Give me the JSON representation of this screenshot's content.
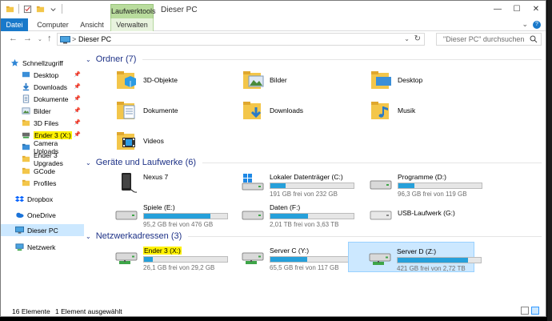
{
  "titlebar": {
    "context_tab": "Laufwerktools",
    "title": "Dieser PC",
    "minimize": "—",
    "maximize": "☐",
    "close": "✕"
  },
  "ribbon": {
    "tabs": [
      "Datei",
      "Computer",
      "Ansicht",
      "Verwalten"
    ]
  },
  "address": {
    "crumb": "Dieser PC",
    "separator": ">"
  },
  "search": {
    "placeholder": "\"Dieser PC\" durchsuchen"
  },
  "sidebar": {
    "items": [
      {
        "label": "Schnellzugriff",
        "icon": "star-icon"
      },
      {
        "label": "Desktop",
        "icon": "desktop-icon",
        "pinned": true
      },
      {
        "label": "Downloads",
        "icon": "download-icon",
        "pinned": true
      },
      {
        "label": "Dokumente",
        "icon": "documents-icon",
        "pinned": true
      },
      {
        "label": "Bilder",
        "icon": "pictures-icon",
        "pinned": true
      },
      {
        "label": "3D Files",
        "icon": "folder-icon",
        "pinned": true
      },
      {
        "label": "Ender 3 (X:)",
        "icon": "network-drive-icon",
        "pinned": true
      },
      {
        "label": "Camera Uploads",
        "icon": "folder-icon"
      },
      {
        "label": "Ender 3 Upgrades",
        "icon": "folder-icon"
      },
      {
        "label": "GCode",
        "icon": "folder-icon"
      },
      {
        "label": "Profiles",
        "icon": "folder-icon"
      },
      {
        "label": "Dropbox",
        "icon": "dropbox-icon"
      },
      {
        "label": "OneDrive",
        "icon": "onedrive-icon"
      },
      {
        "label": "Dieser PC",
        "icon": "pc-icon"
      },
      {
        "label": "Netzwerk",
        "icon": "network-icon"
      }
    ]
  },
  "groups": {
    "folders": {
      "header": "Ordner (7)",
      "items": [
        "3D-Objekte",
        "Bilder",
        "Desktop",
        "Dokumente",
        "Downloads",
        "Musik",
        "Videos"
      ]
    },
    "devices": {
      "header": "Geräte und Laufwerke (6)",
      "items": [
        {
          "name": "Nexus 7",
          "info": ""
        },
        {
          "name": "Lokaler Datenträger (C:)",
          "info": "191 GB frei von 232 GB",
          "used": 0.18
        },
        {
          "name": "Programme (D:)",
          "info": "96,3 GB frei von 119 GB",
          "used": 0.19
        },
        {
          "name": "Spiele (E:)",
          "info": "95,2 GB frei von 476 GB",
          "used": 0.8
        },
        {
          "name": "Daten (F:)",
          "info": "2,01 TB frei von 3,63 TB",
          "used": 0.45
        },
        {
          "name": "USB-Laufwerk (G:)",
          "info": ""
        }
      ]
    },
    "network": {
      "header": "Netzwerkadressen (3)",
      "items": [
        {
          "name": "Ender 3 (X:)",
          "info": "26,1 GB frei von 29,2 GB",
          "used": 0.11
        },
        {
          "name": "Server C (Y:)",
          "info": "65,5 GB frei von 117 GB",
          "used": 0.44
        },
        {
          "name": "Server D (Z:)",
          "info": "421 GB frei von 2,72 TB",
          "used": 0.85
        }
      ]
    }
  },
  "status": {
    "count": "16 Elemente",
    "selected": "1 Element ausgewählt"
  },
  "colors": {
    "accent": "#1979ca",
    "bar_fill": "#26a0da",
    "header_text": "#1e3287",
    "selection": "#cce8ff",
    "highlight": "#fff200"
  }
}
